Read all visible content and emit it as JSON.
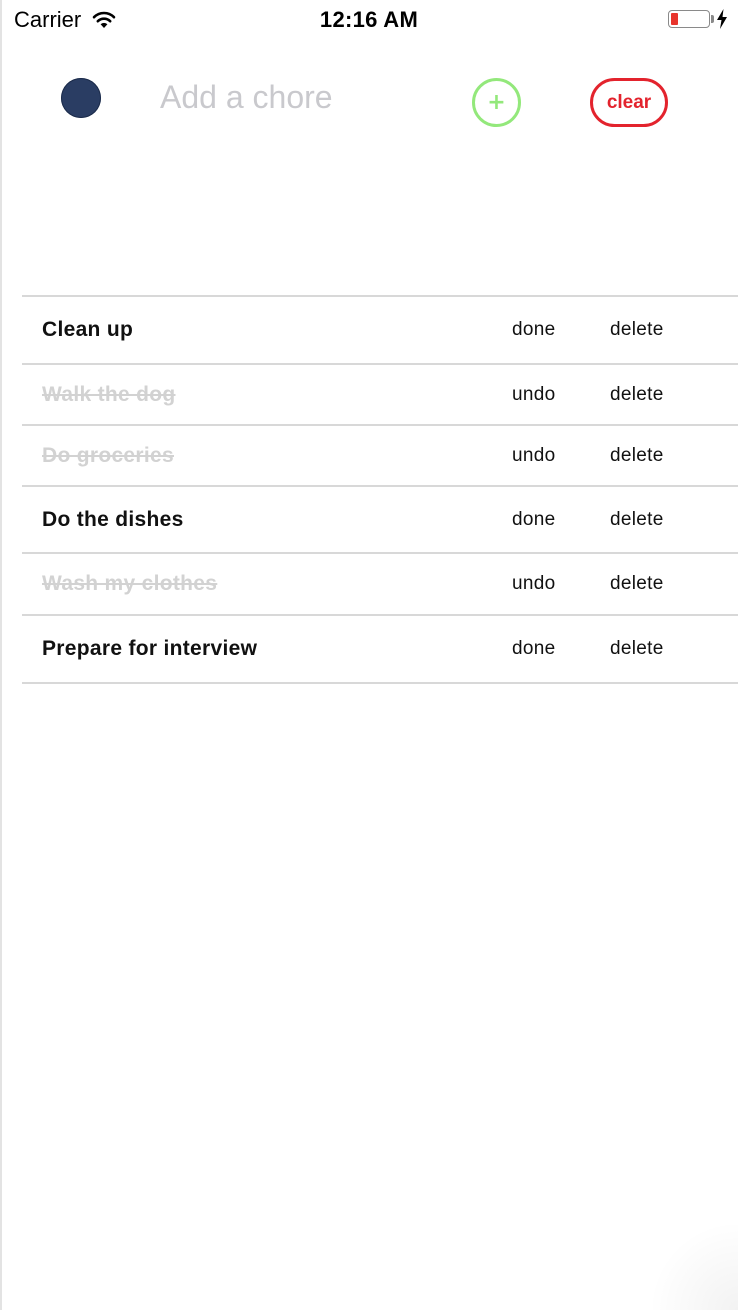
{
  "status_bar": {
    "carrier": "Carrier",
    "time": "12:16 AM",
    "battery_level": 0.2,
    "battery_color": "#e8342c"
  },
  "header": {
    "avatar_color": "#2a3d63",
    "input_value": "",
    "input_placeholder": "Add a chore",
    "add_label": "+",
    "add_color": "#93e87b",
    "clear_label": "clear",
    "clear_color": "#e3232d"
  },
  "chores": [
    {
      "title": "Clean up",
      "completed": false,
      "toggle_label": "done",
      "delete_label": "delete"
    },
    {
      "title": "Walk the dog",
      "completed": true,
      "toggle_label": "undo",
      "delete_label": "delete"
    },
    {
      "title": "Do groceries",
      "completed": true,
      "toggle_label": "undo",
      "delete_label": "delete"
    },
    {
      "title": "Do the dishes",
      "completed": false,
      "toggle_label": "done",
      "delete_label": "delete"
    },
    {
      "title": "Wash my clothes",
      "completed": true,
      "toggle_label": "undo",
      "delete_label": "delete"
    },
    {
      "title": "Prepare for interview",
      "completed": false,
      "toggle_label": "done",
      "delete_label": "delete"
    }
  ]
}
